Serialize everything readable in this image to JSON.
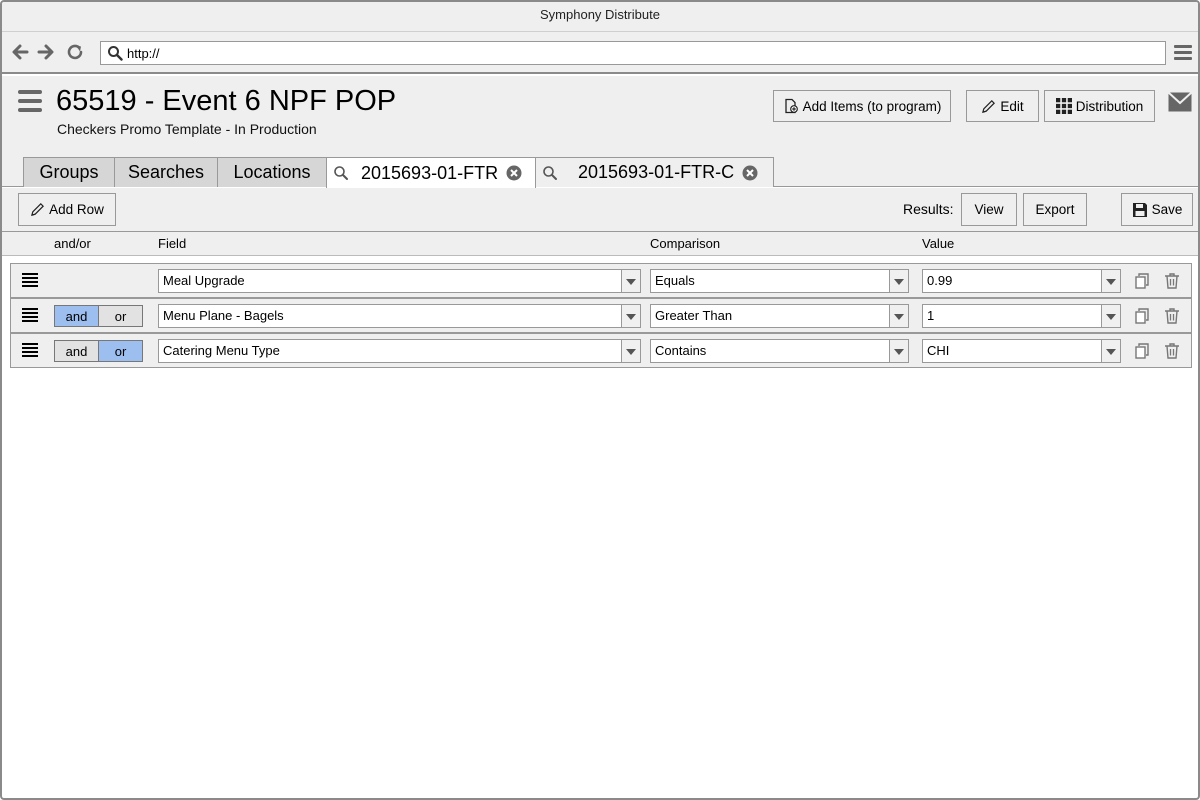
{
  "window": {
    "title": "Symphony Distribute"
  },
  "browser": {
    "url": "http://"
  },
  "header": {
    "title": "65519 - Event 6 NPF POP",
    "subtitle": "Checkers Promo Template - In Production",
    "buttons": {
      "add_items": "Add Items (to program)",
      "edit": "Edit",
      "distribution": "Distribution"
    }
  },
  "tabs": [
    {
      "label": "Groups"
    },
    {
      "label": "Searches"
    },
    {
      "label": "Locations"
    },
    {
      "label": "2015693-01-FTR",
      "active": true
    },
    {
      "label": "2015693-01-FTR-C",
      "active": false
    }
  ],
  "toolbar": {
    "add_row": "Add Row",
    "results_label": "Results:",
    "view": "View",
    "export": "Export",
    "save": "Save"
  },
  "columns": {
    "andor": "and/or",
    "field": "Field",
    "comparison": "Comparison",
    "value": "Value"
  },
  "rows": [
    {
      "andor": null,
      "field": "Meal Upgrade",
      "comparison": "Equals",
      "value": "0.99"
    },
    {
      "andor": "and",
      "and_label": "and",
      "or_label": "or",
      "field": "Menu Plane - Bagels",
      "comparison": "Greater Than",
      "value": "1"
    },
    {
      "andor": "or",
      "and_label": "and",
      "or_label": "or",
      "field": "Catering Menu Type",
      "comparison": "Contains",
      "value": "CHI"
    }
  ],
  "colors": {
    "selected_toggle": "#9dbff0",
    "chrome_bg": "#efefef",
    "border": "#999999"
  }
}
